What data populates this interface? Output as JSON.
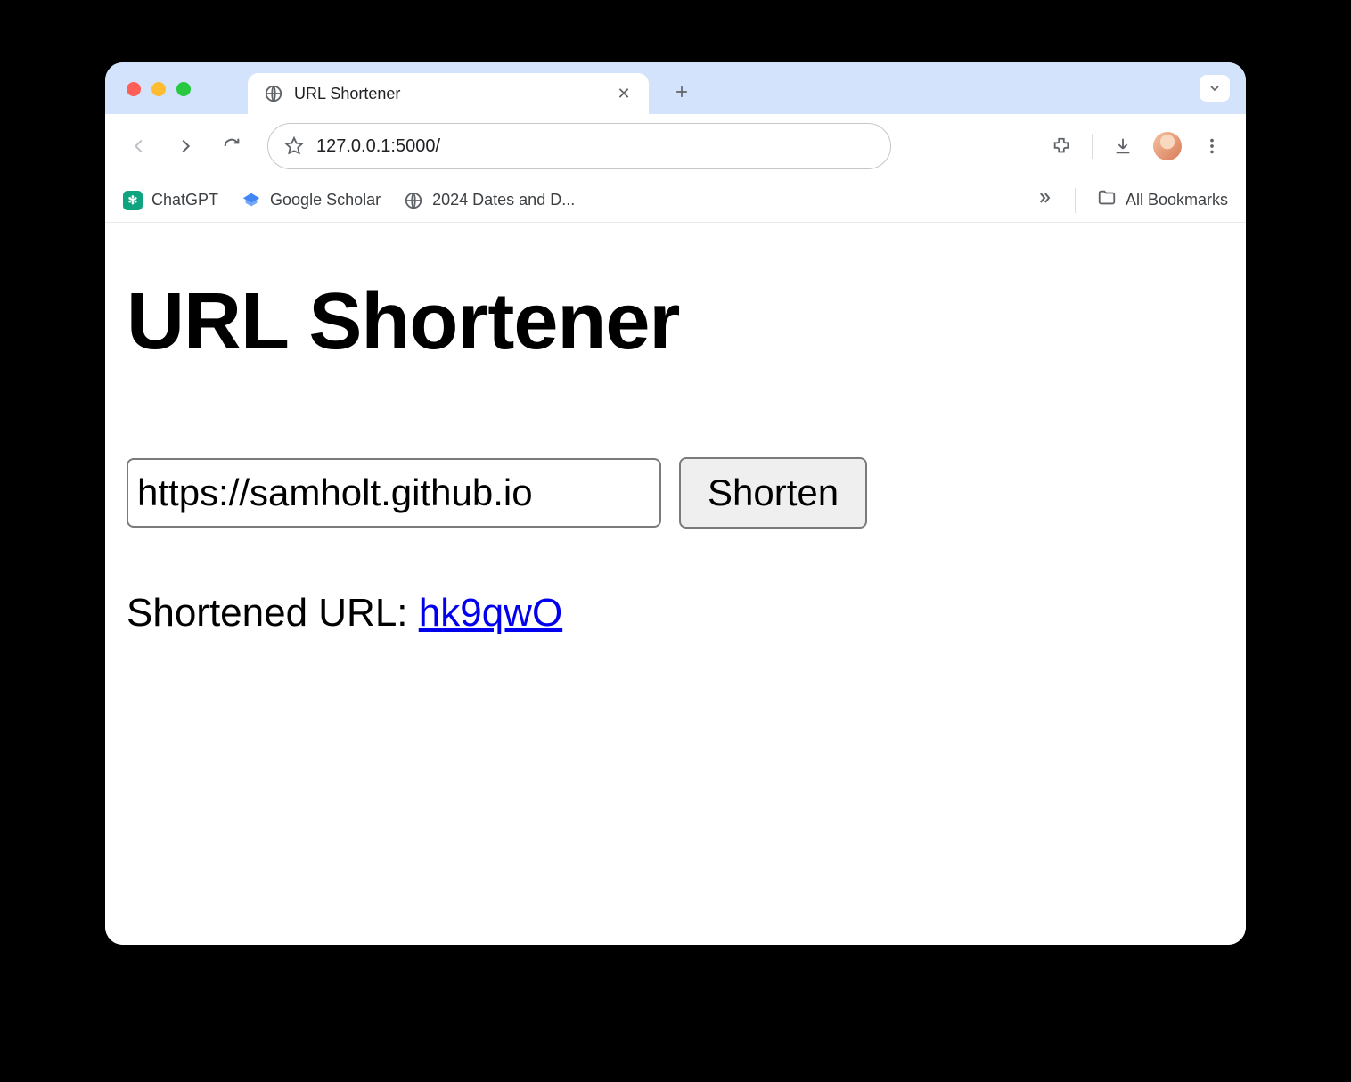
{
  "browser": {
    "tab_title": "URL Shortener",
    "address": "127.0.0.1:5000/",
    "bookmarks": [
      {
        "label": "ChatGPT"
      },
      {
        "label": "Google Scholar"
      },
      {
        "label": "2024 Dates and D..."
      }
    ],
    "all_bookmarks_label": "All Bookmarks"
  },
  "page": {
    "heading": "URL Shortener",
    "input_value": "https://samholt.github.io",
    "button_label": "Shorten",
    "result_label": "Shortened URL: ",
    "short_code": "hk9qwO"
  }
}
